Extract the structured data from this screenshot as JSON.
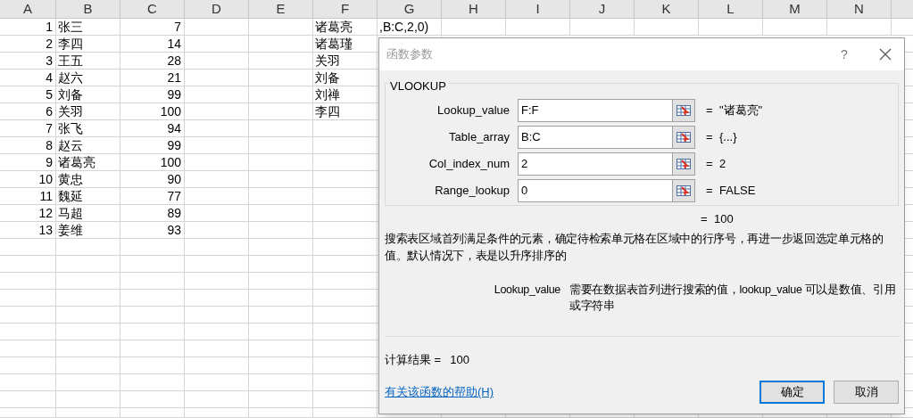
{
  "sheet": {
    "columns": [
      "A",
      "B",
      "C",
      "D",
      "E",
      "F",
      "G",
      "H",
      "I",
      "J",
      "K",
      "L",
      "M",
      "N"
    ],
    "rows": [
      {
        "A": "1",
        "B": "张三",
        "C": "7",
        "F": "诸葛亮",
        "G": ",B:C,2,0)"
      },
      {
        "A": "2",
        "B": "李四",
        "C": "14",
        "F": "诸葛瑾"
      },
      {
        "A": "3",
        "B": "王五",
        "C": "28",
        "F": "关羽"
      },
      {
        "A": "4",
        "B": "赵六",
        "C": "21",
        "F": "刘备"
      },
      {
        "A": "5",
        "B": "刘备",
        "C": "99",
        "F": "刘禅"
      },
      {
        "A": "6",
        "B": "关羽",
        "C": "100",
        "F": "李四"
      },
      {
        "A": "7",
        "B": "张飞",
        "C": "94"
      },
      {
        "A": "8",
        "B": "赵云",
        "C": "99"
      },
      {
        "A": "9",
        "B": "诸葛亮",
        "C": "100"
      },
      {
        "A": "10",
        "B": "黄忠",
        "C": "90"
      },
      {
        "A": "11",
        "B": "魏延",
        "C": "77"
      },
      {
        "A": "12",
        "B": "马超",
        "C": "89"
      },
      {
        "A": "13",
        "B": "姜维",
        "C": "93"
      }
    ]
  },
  "dialog": {
    "title": "函数参数",
    "help_button": "?",
    "function_name": "VLOOKUP",
    "arguments": [
      {
        "label": "Lookup_value",
        "value": "F:F",
        "equals": "=",
        "result": "\"诸葛亮\""
      },
      {
        "label": "Table_array",
        "value": "B:C",
        "equals": "=",
        "result": "{...}"
      },
      {
        "label": "Col_index_num",
        "value": "2",
        "equals": "=",
        "result": "2"
      },
      {
        "label": "Range_lookup",
        "value": "0",
        "equals": "=",
        "result": "FALSE"
      }
    ],
    "formula_equals": "=",
    "formula_value": "100",
    "description": "搜索表区域首列满足条件的元素，确定待检索单元格在区域中的行序号，再进一步返回选定单元格的值。默认情况下，表是以升序排序的",
    "argument_help": {
      "name": "Lookup_value",
      "text": "需要在数据表首列进行搜索的值，lookup_value 可以是数值、引用或字符串"
    },
    "result_label": "计算结果 =",
    "result_value": "100",
    "help_link": "有关该函数的帮助(H)",
    "buttons": [
      {
        "label": "确定",
        "default": true
      },
      {
        "label": "取消",
        "default": false
      }
    ]
  }
}
